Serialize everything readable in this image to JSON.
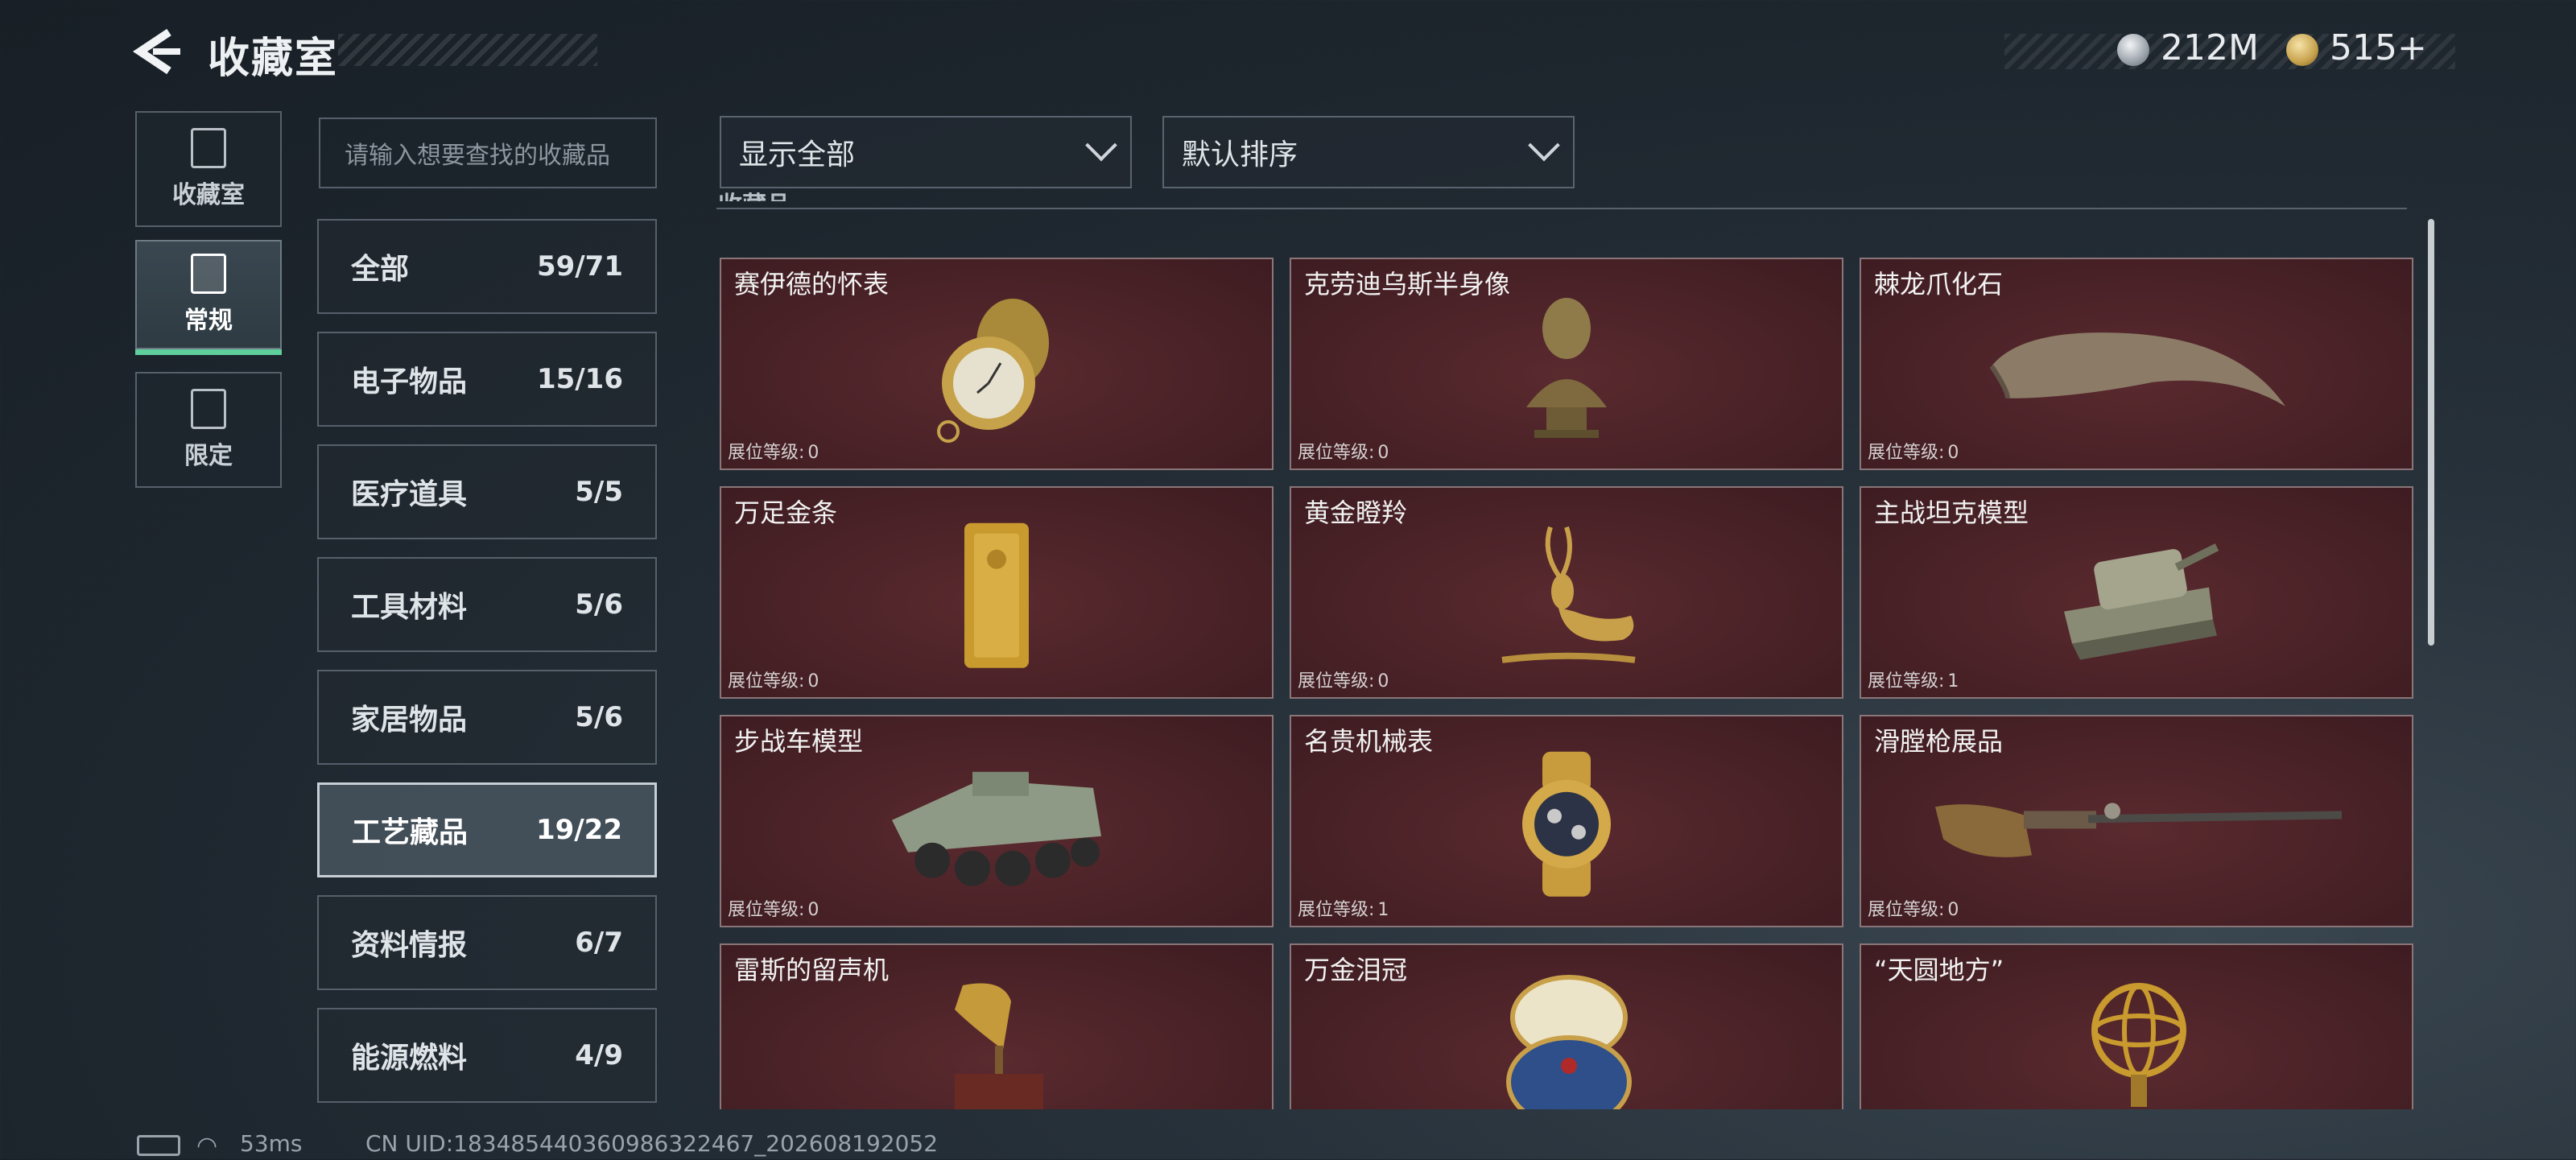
{
  "header": {
    "title": "收藏室",
    "currency_silver": "212M",
    "currency_gold": "515+"
  },
  "nav": [
    {
      "label": "收藏室"
    },
    {
      "label": "常规"
    },
    {
      "label": "限定"
    }
  ],
  "search": {
    "placeholder": "请输入想要查找的收藏品"
  },
  "categories": [
    {
      "name": "全部",
      "count": "59/71"
    },
    {
      "name": "电子物品",
      "count": "15/16"
    },
    {
      "name": "医疗道具",
      "count": "5/5"
    },
    {
      "name": "工具材料",
      "count": "5/6"
    },
    {
      "name": "家居物品",
      "count": "5/6"
    },
    {
      "name": "工艺藏品",
      "count": "19/22"
    },
    {
      "name": "资料情报",
      "count": "6/7"
    },
    {
      "name": "能源燃料",
      "count": "4/9"
    }
  ],
  "filter": {
    "show_label": "显示全部",
    "sort_label": "默认排序"
  },
  "section_title_fragment": "收藏品",
  "level_label": "展位等级:",
  "items": [
    {
      "name": "赛伊德的怀表",
      "level": "0",
      "icon": "pocket-watch-icon"
    },
    {
      "name": "克劳迪乌斯半身像",
      "level": "0",
      "icon": "bust-icon"
    },
    {
      "name": "棘龙爪化石",
      "level": "0",
      "icon": "claw-fossil-icon"
    },
    {
      "name": "万足金条",
      "level": "0",
      "icon": "gold-bar-icon"
    },
    {
      "name": "黄金瞪羚",
      "level": "0",
      "icon": "gazelle-icon"
    },
    {
      "name": "主战坦克模型",
      "level": "1",
      "icon": "tank-model-icon"
    },
    {
      "name": "步战车模型",
      "level": "0",
      "icon": "ifv-model-icon"
    },
    {
      "name": "名贵机械表",
      "level": "1",
      "icon": "wristwatch-icon"
    },
    {
      "name": "滑膛枪展品",
      "level": "0",
      "icon": "musket-icon"
    },
    {
      "name": "雷斯的留声机",
      "level": "",
      "icon": "gramophone-icon"
    },
    {
      "name": "万金泪冠",
      "level": "",
      "icon": "jeweled-egg-icon"
    },
    {
      "name": "“天圆地方”",
      "level": "",
      "icon": "armillary-sphere-icon"
    }
  ],
  "status": {
    "ping": "53ms",
    "uid": "CN UID:18348544036098632246​7_202608192052"
  }
}
